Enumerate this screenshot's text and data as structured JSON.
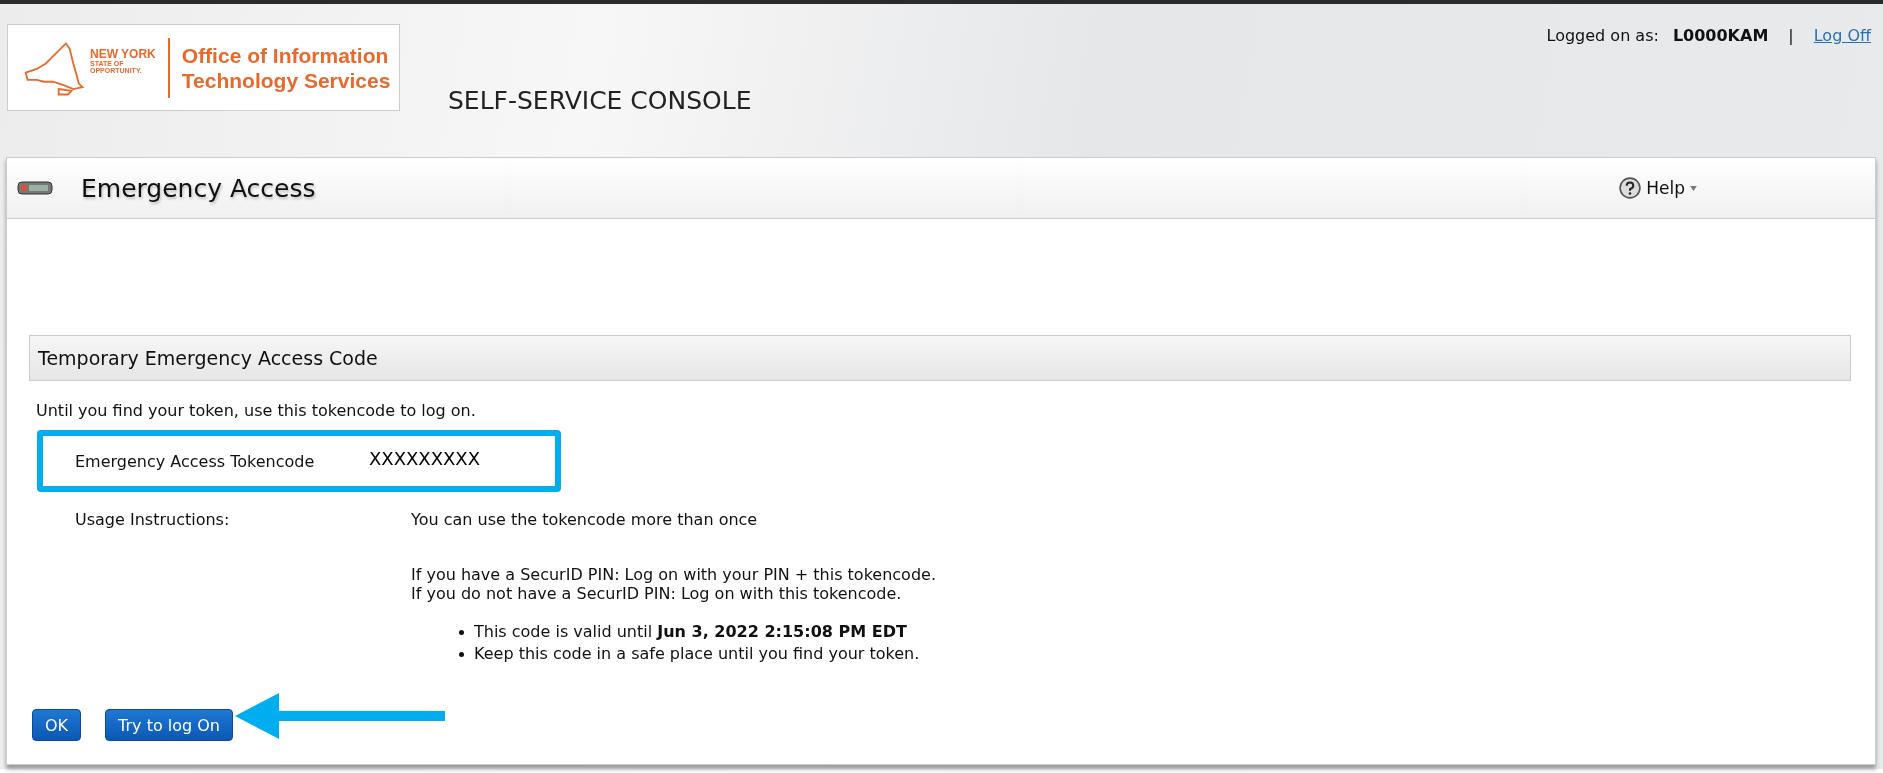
{
  "header": {
    "logo": {
      "state_line_1": "NEW YORK",
      "state_line_2": "STATE OF",
      "state_line_3": "OPPORTUNITY.",
      "agency_line_1": "Office of Information",
      "agency_line_2": "Technology Services"
    },
    "console_title": "SELF-SERVICE CONSOLE",
    "user": {
      "label": "Logged on as:",
      "id": "L0000KAM",
      "separator": "|",
      "logoff": "Log Off"
    }
  },
  "title_bar": {
    "title": "Emergency Access",
    "help": "Help"
  },
  "section": {
    "heading": "Temporary Emergency Access Code",
    "intro": "Until you find your token, use this tokencode to log on.",
    "tokencode": {
      "label": "Emergency Access Tokencode",
      "value": "XXXXXXXXX",
      "highlighted": true
    },
    "usage": {
      "label": "Usage Instructions:",
      "lines": [
        "You can use the tokencode more than once",
        "If you have a SecurID PIN: Log on with your PIN + this tokencode.",
        "If you do not have a SecurID PIN: Log on with this tokencode."
      ],
      "bullets": [
        "This code is valid until **Jun 3, 2022 2:15:08 PM EDT**",
        "Keep this code in a safe place until you find your token."
      ]
    }
  },
  "buttons": [
    {
      "label": "OK",
      "pointed": false
    },
    {
      "label": "Try to log On",
      "pointed": true
    }
  ]
}
